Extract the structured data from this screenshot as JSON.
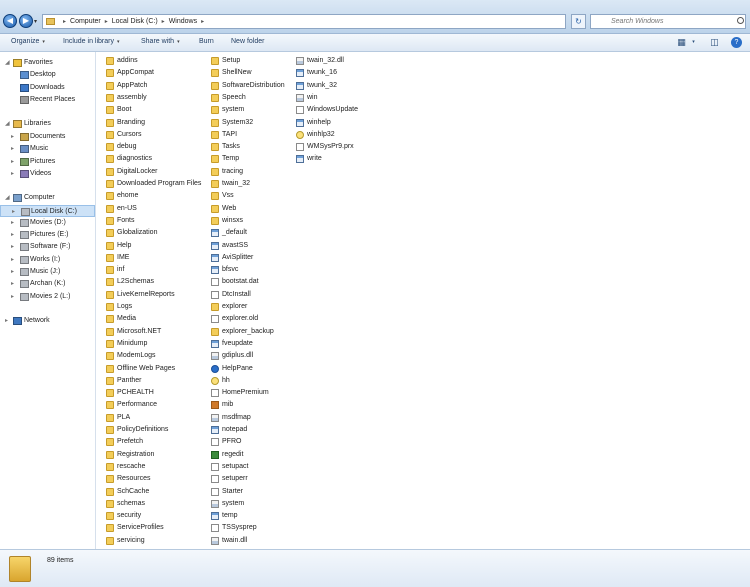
{
  "address": {
    "crumbs": [
      "Computer",
      "Local Disk (C:)",
      "Windows"
    ],
    "search_placeholder": "Search Windows"
  },
  "toolbar": {
    "organize": "Organize",
    "include_in_library": "Include in library",
    "share_with": "Share with",
    "burn": "Burn",
    "new_folder": "New folder"
  },
  "nav": {
    "favorites_header": "Favorites",
    "favorites": [
      "Desktop",
      "Downloads",
      "Recent Places"
    ],
    "libraries_header": "Libraries",
    "libraries": [
      "Documents",
      "Music",
      "Pictures",
      "Videos"
    ],
    "computer_header": "Computer",
    "drives": [
      "Local Disk (C:)",
      "Movies (D:)",
      "Pictures (E:)",
      "Software (F:)",
      "Works (I:)",
      "Music (J:)",
      "Archan (K:)",
      "Movies 2 (L:)"
    ],
    "network": "Network"
  },
  "columns": [
    [
      {
        "name": "addins",
        "icon": "folder"
      },
      {
        "name": "AppCompat",
        "icon": "folder"
      },
      {
        "name": "AppPatch",
        "icon": "folder"
      },
      {
        "name": "assembly",
        "icon": "folder"
      },
      {
        "name": "Boot",
        "icon": "folder"
      },
      {
        "name": "Branding",
        "icon": "folder"
      },
      {
        "name": "Cursors",
        "icon": "folder"
      },
      {
        "name": "debug",
        "icon": "folder"
      },
      {
        "name": "diagnostics",
        "icon": "folder"
      },
      {
        "name": "DigitalLocker",
        "icon": "folder"
      },
      {
        "name": "Downloaded Program Files",
        "icon": "folder"
      },
      {
        "name": "ehome",
        "icon": "folder"
      },
      {
        "name": "en-US",
        "icon": "folder"
      },
      {
        "name": "Fonts",
        "icon": "folder"
      },
      {
        "name": "Globalization",
        "icon": "folder"
      },
      {
        "name": "Help",
        "icon": "folder"
      },
      {
        "name": "IME",
        "icon": "folder"
      },
      {
        "name": "inf",
        "icon": "folder"
      },
      {
        "name": "L2Schemas",
        "icon": "folder"
      },
      {
        "name": "LiveKernelReports",
        "icon": "folder"
      },
      {
        "name": "Logs",
        "icon": "folder"
      },
      {
        "name": "Media",
        "icon": "folder"
      },
      {
        "name": "Microsoft.NET",
        "icon": "folder"
      },
      {
        "name": "Minidump",
        "icon": "folder"
      },
      {
        "name": "ModemLogs",
        "icon": "folder"
      },
      {
        "name": "Offline Web Pages",
        "icon": "folder"
      },
      {
        "name": "Panther",
        "icon": "folder"
      },
      {
        "name": "PCHEALTH",
        "icon": "folder"
      },
      {
        "name": "Performance",
        "icon": "folder"
      },
      {
        "name": "PLA",
        "icon": "folder"
      },
      {
        "name": "PolicyDefinitions",
        "icon": "folder"
      },
      {
        "name": "Prefetch",
        "icon": "folder"
      },
      {
        "name": "Registration",
        "icon": "folder"
      },
      {
        "name": "rescache",
        "icon": "folder"
      },
      {
        "name": "Resources",
        "icon": "folder"
      },
      {
        "name": "SchCache",
        "icon": "folder"
      },
      {
        "name": "schemas",
        "icon": "folder"
      },
      {
        "name": "security",
        "icon": "folder"
      },
      {
        "name": "ServiceProfiles",
        "icon": "folder"
      },
      {
        "name": "servicing",
        "icon": "folder"
      }
    ],
    [
      {
        "name": "Setup",
        "icon": "folder"
      },
      {
        "name": "ShellNew",
        "icon": "folder"
      },
      {
        "name": "SoftwareDistribution",
        "icon": "folder"
      },
      {
        "name": "Speech",
        "icon": "folder"
      },
      {
        "name": "system",
        "icon": "folder"
      },
      {
        "name": "System32",
        "icon": "folder"
      },
      {
        "name": "TAPI",
        "icon": "folder"
      },
      {
        "name": "Tasks",
        "icon": "folder"
      },
      {
        "name": "Temp",
        "icon": "folder"
      },
      {
        "name": "tracing",
        "icon": "folder"
      },
      {
        "name": "twain_32",
        "icon": "folder"
      },
      {
        "name": "Vss",
        "icon": "folder"
      },
      {
        "name": "Web",
        "icon": "folder"
      },
      {
        "name": "winsxs",
        "icon": "folder"
      },
      {
        "name": "_default",
        "icon": "exe"
      },
      {
        "name": "avastSS",
        "icon": "exe"
      },
      {
        "name": "AviSplitter",
        "icon": "exe"
      },
      {
        "name": "bfsvc",
        "icon": "exe"
      },
      {
        "name": "bootstat.dat",
        "icon": "file"
      },
      {
        "name": "DtcInstall",
        "icon": "file"
      },
      {
        "name": "explorer",
        "icon": "folder"
      },
      {
        "name": "explorer.old",
        "icon": "file"
      },
      {
        "name": "explorer_backup",
        "icon": "folder"
      },
      {
        "name": "fveupdate",
        "icon": "exe"
      },
      {
        "name": "gdiplus.dll",
        "icon": "dll"
      },
      {
        "name": "HelpPane",
        "icon": "helppane"
      },
      {
        "name": "hh",
        "icon": "help"
      },
      {
        "name": "HomePremium",
        "icon": "file"
      },
      {
        "name": "mib",
        "icon": "special"
      },
      {
        "name": "msdfmap",
        "icon": "dll"
      },
      {
        "name": "notepad",
        "icon": "exe"
      },
      {
        "name": "PFRO",
        "icon": "file"
      },
      {
        "name": "regedit",
        "icon": "green"
      },
      {
        "name": "setupact",
        "icon": "file"
      },
      {
        "name": "setuperr",
        "icon": "file"
      },
      {
        "name": "Starter",
        "icon": "file"
      },
      {
        "name": "system",
        "icon": "dll"
      },
      {
        "name": "temp",
        "icon": "exe"
      },
      {
        "name": "TSSysprep",
        "icon": "file"
      },
      {
        "name": "twain.dll",
        "icon": "dll"
      }
    ],
    [
      {
        "name": "twain_32.dll",
        "icon": "dll"
      },
      {
        "name": "twunk_16",
        "icon": "exe"
      },
      {
        "name": "twunk_32",
        "icon": "exe"
      },
      {
        "name": "win",
        "icon": "dll"
      },
      {
        "name": "WindowsUpdate",
        "icon": "file"
      },
      {
        "name": "winhelp",
        "icon": "exe"
      },
      {
        "name": "winhlp32",
        "icon": "help"
      },
      {
        "name": "WMSysPr9.prx",
        "icon": "file"
      },
      {
        "name": "write",
        "icon": "exe"
      }
    ]
  ],
  "status": {
    "item_count": "89 items"
  },
  "colors": {
    "selection": "#cde2f7",
    "folder": "#f3cd59",
    "chrome": "#dbe8f5"
  }
}
